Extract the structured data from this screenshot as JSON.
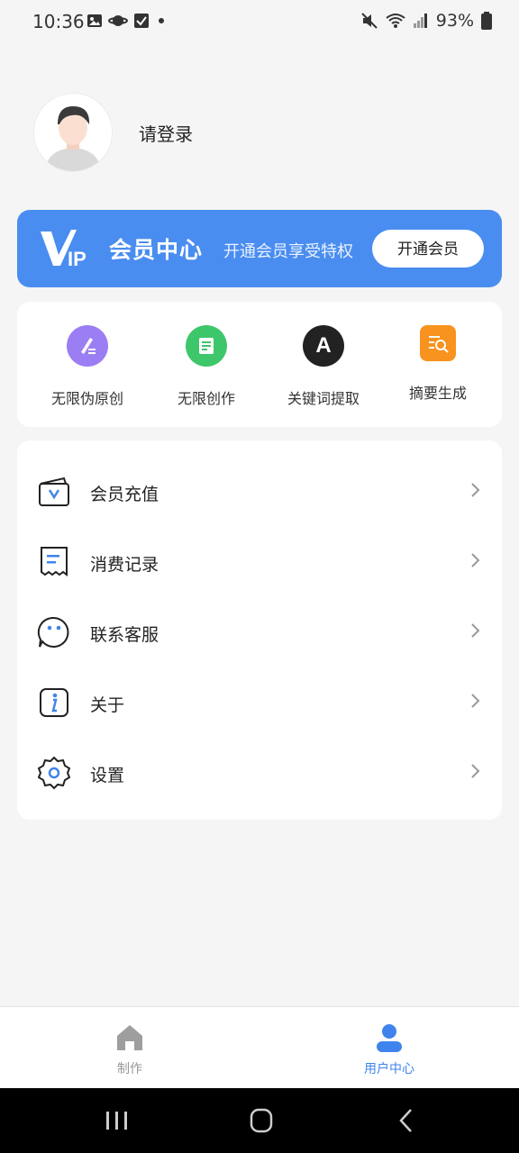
{
  "status_bar": {
    "time": "10:36",
    "battery": "93%"
  },
  "profile": {
    "login_text": "请登录"
  },
  "vip": {
    "logo_text": "VIP",
    "title": "会员中心",
    "subtitle": "开通会员享受特权",
    "button": "开通会员"
  },
  "tools": [
    {
      "label": "无限伪原创",
      "icon": "pen-icon",
      "color": "#9b7ef4"
    },
    {
      "label": "无限创作",
      "icon": "scroll-icon",
      "color": "#3ec76a"
    },
    {
      "label": "关键词提取",
      "icon": "letter-a-icon",
      "color": "#222222",
      "glyph": "A"
    },
    {
      "label": "摘要生成",
      "icon": "document-search-icon",
      "color": "#f7931e"
    }
  ],
  "menu": [
    {
      "label": "会员充值",
      "icon": "wallet-v-icon"
    },
    {
      "label": "消费记录",
      "icon": "receipt-icon"
    },
    {
      "label": "联系客服",
      "icon": "chat-face-icon"
    },
    {
      "label": "关于",
      "icon": "info-icon"
    },
    {
      "label": "设置",
      "icon": "gear-icon"
    }
  ],
  "tabs": [
    {
      "label": "制作",
      "icon": "home-icon",
      "active": false
    },
    {
      "label": "用户中心",
      "icon": "user-icon",
      "active": true
    }
  ],
  "colors": {
    "accent": "#3f84ec",
    "vip_bg": "#4a8df0",
    "inactive": "#999999"
  }
}
